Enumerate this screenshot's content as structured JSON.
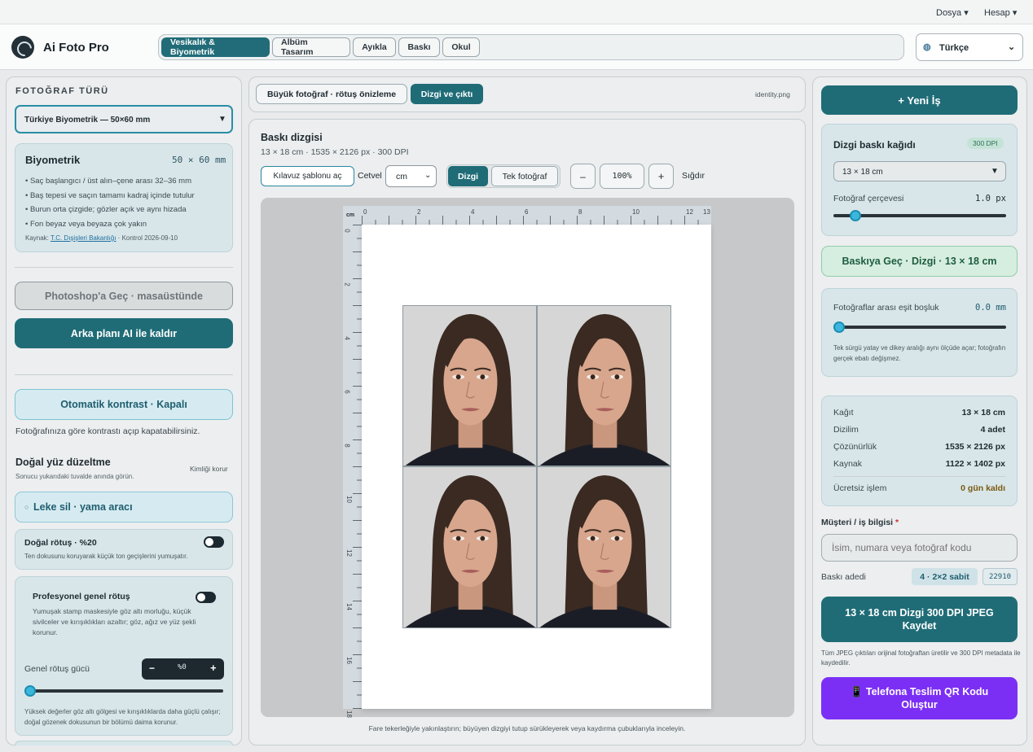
{
  "menu": {
    "file": "Dosya ▾",
    "account": "Hesap ▾"
  },
  "app": {
    "name": "Ai Foto Pro"
  },
  "tabs": [
    "Vesikalık & Biyometrik",
    "Albüm Tasarım",
    "Ayıkla",
    "Baskı",
    "Okul"
  ],
  "language": {
    "value": "Türkçe"
  },
  "left": {
    "section_title": "FOTOĞRAF TÜRÜ",
    "photo_type": "Türkiye Biyometrik — 50×60 mm",
    "bio": {
      "title": "Biyometrik",
      "size": "50 × 60 mm",
      "rules": [
        "• Saç başlangıcı / üst alın–çene arası 32–36 mm",
        "• Baş tepesi ve saçın tamamı kadraj içinde tutulur",
        "• Burun orta çizgide; gözler açık ve aynı hizada",
        "• Fon beyaz veya beyaza çok yakın"
      ],
      "source_prefix": "Kaynak: ",
      "source_link": "T.C. Dışişleri Bakanlığı",
      "source_suffix": " · Kontrol 2026-09-10"
    },
    "photoshop_btn": "Photoshop'a Geç · masaüstünde",
    "remove_bg_btn": "Arka planı AI ile kaldır",
    "auto_contrast_btn": "Otomatik kontrast · Kapalı",
    "auto_contrast_desc": "Fotoğrafınıza göre kontrastı açıp kapatabilirsiniz.",
    "natural_face": {
      "title": "Doğal yüz düzeltme",
      "desc": "Sonucu yukarıdaki tuvalde anında görün.",
      "badge": "Kimliği korur"
    },
    "spot_btn": "Leke sil · yama aracı",
    "natural_retouch": {
      "title": "Doğal rötuş · %20",
      "desc": "Ten dokusunu koruyarak küçük ton geçişlerini yumuşatır."
    },
    "pro_retouch": {
      "title": "Profesyonel genel rötuş",
      "desc": "Yumuşak stamp maskesiyle göz altı morluğu, küçük sivilceler ve kırışıklıkları azaltır; göz, ağız ve yüz şekli korunur.",
      "strength_label": "Genel rötuş gücü",
      "strength_value": "%0",
      "strength": 0,
      "note": "Yüksek değerler göz altı gölgesi ve kırışıklıklarda daha güçlü çalışır; doğal gözenek dokusunun bir bölümü daima korunur."
    }
  },
  "center": {
    "tab_preview": "Büyük fotoğraf · rötuş önizleme",
    "tab_layout": "Dizgi ve çıktı",
    "filename": "identity.png",
    "layout_title": "Baskı dizgisi",
    "layout_sub": "13 × 18 cm · 1535 × 2126 px · 300 DPI",
    "guide_btn": "Kılavuz şablonu aç",
    "ruler_label": "Cetvel",
    "ruler_unit": "cm",
    "view_dizgi": "Dizgi",
    "view_single": "Tek fotoğraf",
    "zoom_out": "–",
    "zoom": "100%",
    "zoom_in": "+",
    "fit": "Sığdır",
    "ruler_unit_label": "cm",
    "h_ticks": [
      "0",
      "2",
      "4",
      "6",
      "8",
      "10",
      "12",
      "13"
    ],
    "v_ticks": [
      "0",
      "2",
      "4",
      "6",
      "8",
      "10",
      "12",
      "14",
      "16",
      "18"
    ],
    "footer": "Fare tekerleğiyle yakınlaştırın; büyüyen dizgiyi tutup sürükleyerek veya kaydırma çubuklarıyla inceleyin."
  },
  "right": {
    "new_job": "+ Yeni İş",
    "paper_title": "Dizgi baskı kağıdı",
    "dpi_badge": "300 DPI",
    "paper_select": "13 × 18 cm",
    "frame_label": "Fotoğraf çerçevesi",
    "frame_value": "1.0 px",
    "frame": 0.1,
    "print_btn": "Baskıya Geç · Dizgi · 13 × 18 cm",
    "gap_label": "Fotoğraflar arası eşit boşluk",
    "gap_value": "0.0 mm",
    "gap": 0,
    "gap_desc": "Tek sürgü yatay ve dikey aralığı aynı ölçüde açar; fotoğrafın gerçek ebatı değişmez.",
    "summary": [
      {
        "k": "Kağıt",
        "v": "13 × 18 cm"
      },
      {
        "k": "Dizilim",
        "v": "4 adet"
      },
      {
        "k": "Çözünürlük",
        "v": "1535 × 2126 px"
      },
      {
        "k": "Kaynak",
        "v": "1122 × 1402 px"
      }
    ],
    "free_label": "Ücretsiz işlem",
    "free_value": "0 gün kaldı",
    "customer_label": "Müşteri / iş bilgisi",
    "required": "*",
    "customer_placeholder": "İsim, numara veya fotoğraf kodu",
    "copies_label": "Baskı adedi",
    "copies_value": "4 · 2×2 sabit",
    "copies_code": "22910",
    "save_btn": "13 × 18 cm Dizgi 300 DPI JPEG Kaydet",
    "save_note": "Tüm JPEG çıktıları orijinal fotoğraftan üretilir ve 300 DPI metadata ile kaydedilir.",
    "qr_btn": "📱 Telefona Teslim QR Kodu Oluştur"
  }
}
